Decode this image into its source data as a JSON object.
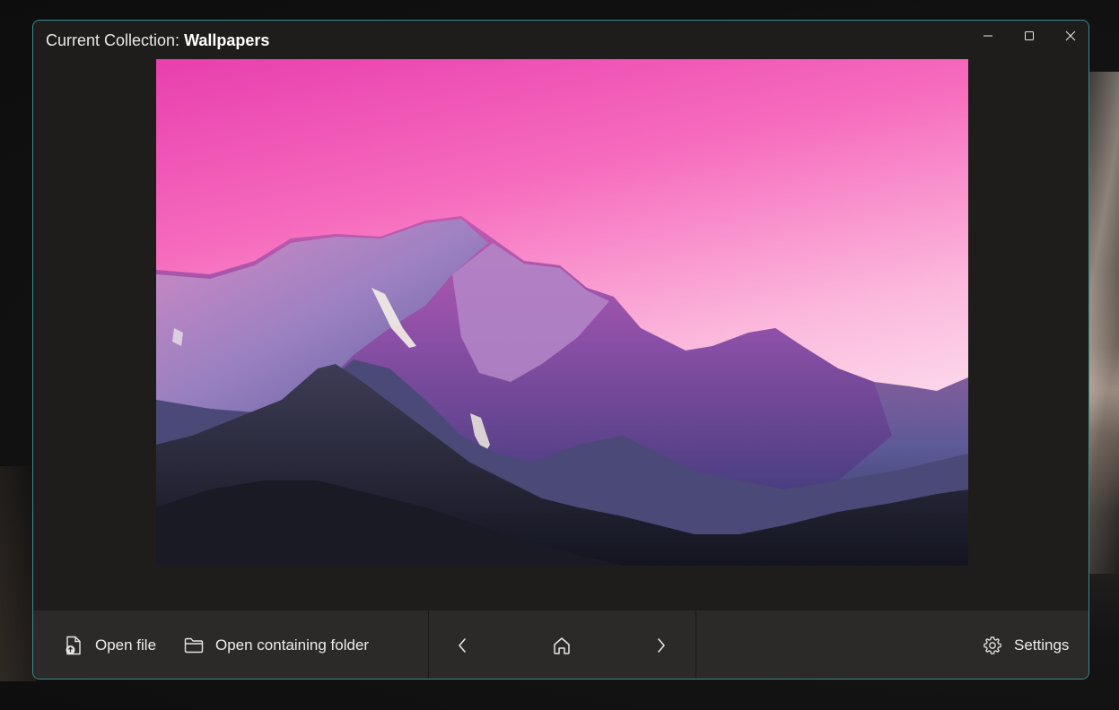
{
  "window": {
    "title_prefix": "Current Collection: ",
    "collection_name": "Wallpapers",
    "accent_border": "#3a8b8f"
  },
  "titlebar_controls": {
    "minimize_icon": "minimize-icon",
    "maximize_icon": "maximize-icon",
    "close_icon": "close-icon"
  },
  "image": {
    "subject": "mountain-landscape-photo",
    "sky_colors": [
      "#f04fb4",
      "#fde3f0"
    ]
  },
  "toolbar": {
    "open_file_label": "Open file",
    "open_file_icon": "open-file-icon",
    "open_folder_label": "Open containing folder",
    "open_folder_icon": "folder-icon",
    "prev_icon": "chevron-left-icon",
    "home_icon": "home-icon",
    "next_icon": "chevron-right-icon",
    "settings_label": "Settings",
    "settings_icon": "gear-icon"
  }
}
